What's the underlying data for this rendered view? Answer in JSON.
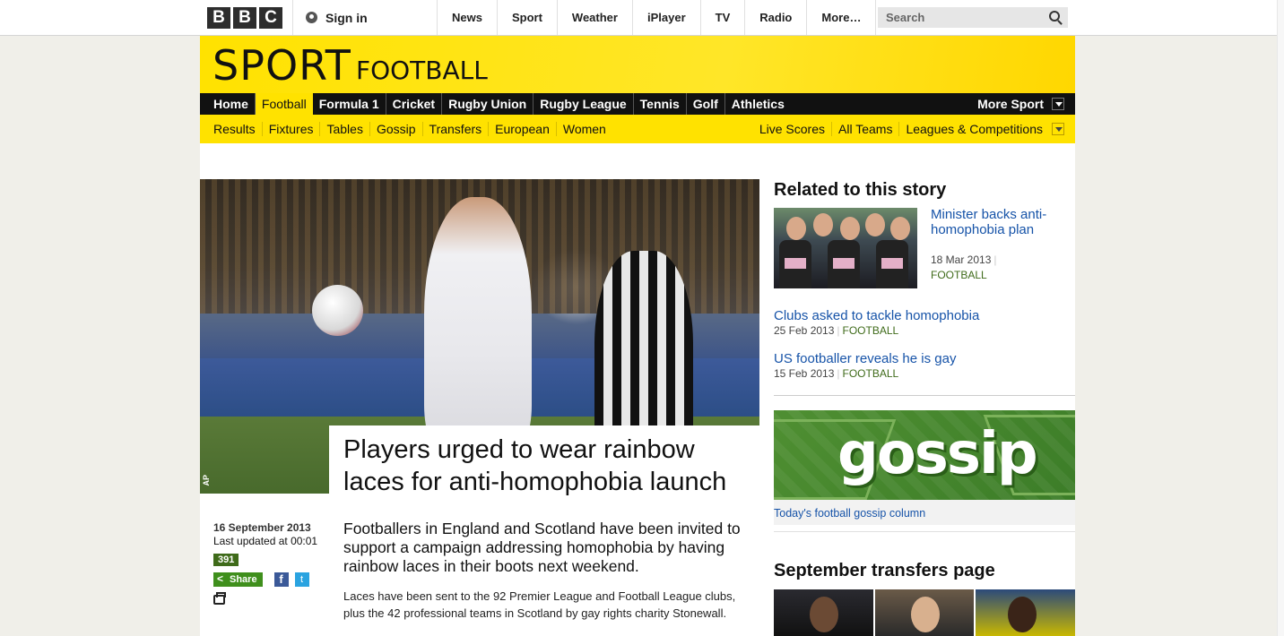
{
  "topbar": {
    "logo_letters": [
      "B",
      "B",
      "C"
    ],
    "sign_in": "Sign in",
    "nav": [
      "News",
      "Sport",
      "Weather",
      "iPlayer",
      "TV",
      "Radio",
      "More…"
    ],
    "search_placeholder": "Search"
  },
  "masthead": {
    "title": "SPORT",
    "section": "FOOTBALL"
  },
  "primary_nav": {
    "items": [
      "Home",
      "Football",
      "Formula 1",
      "Cricket",
      "Rugby Union",
      "Rugby League",
      "Tennis",
      "Golf",
      "Athletics"
    ],
    "active": "Football",
    "more": "More Sport"
  },
  "secondary_nav": {
    "left": [
      "Results",
      "Fixtures",
      "Tables",
      "Gossip",
      "Transfers",
      "European",
      "Women"
    ],
    "right": [
      "Live Scores",
      "All Teams",
      "Leagues & Competitions"
    ]
  },
  "article": {
    "image_credit": "AP",
    "headline": "Players urged to wear rainbow laces for anti-homophobia launch",
    "date": "16 September 2013",
    "last_updated": "Last updated at 00:01",
    "comment_count": "391",
    "share_label": "Share",
    "facebook_glyph": "f",
    "twitter_glyph": "t",
    "intro": "Footballers in England and Scotland have been invited to support a campaign addressing homophobia by having rainbow laces in their boots next weekend.",
    "body": "Laces have been sent to the 92 Premier League and Football League clubs, plus the 42 professional teams in Scotland by gay rights charity Stonewall."
  },
  "related": {
    "title": "Related to this story",
    "items": [
      {
        "headline": "Minister backs anti-homophobia plan",
        "date": "18 Mar 2013",
        "category": "FOOTBALL"
      },
      {
        "headline": "Clubs asked to tackle homophobia",
        "date": "25 Feb 2013",
        "category": "FOOTBALL"
      },
      {
        "headline": "US footballer reveals he is gay",
        "date": "15 Feb 2013",
        "category": "FOOTBALL"
      }
    ]
  },
  "gossip": {
    "word": "gossip",
    "caption": "Today's football gossip column"
  },
  "transfers": {
    "title": "September transfers page"
  },
  "colors": {
    "sport_yellow": "#ffe200",
    "link_blue": "#1653a8",
    "category_green": "#3f6b1a"
  }
}
